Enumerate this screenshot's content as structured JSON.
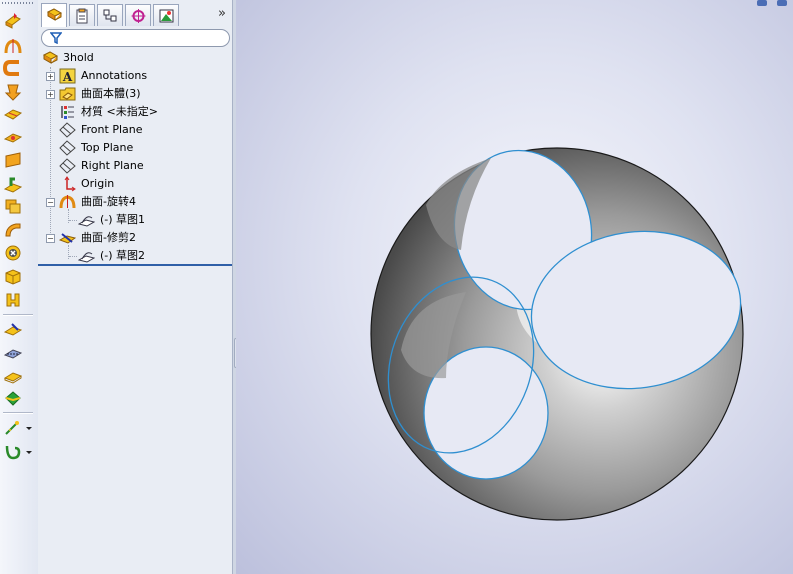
{
  "window": {
    "app": "SolidWorks"
  },
  "toolbar": {
    "buttons": [
      {
        "name": "extruded-surface-icon"
      },
      {
        "name": "revolved-surface-icon"
      },
      {
        "name": "swept-surface-icon"
      },
      {
        "name": "lofted-surface-icon"
      },
      {
        "name": "boundary-surface-icon"
      },
      {
        "name": "planar-surface-icon"
      },
      {
        "name": "filled-surface-icon"
      },
      {
        "name": "offset-surface-icon"
      },
      {
        "name": "ruled-surface-icon"
      },
      {
        "name": "delete-face-icon"
      },
      {
        "name": "replace-face-icon"
      },
      {
        "name": "untrim-surface-icon"
      },
      {
        "name": "extend-surface-icon"
      },
      {
        "name": "trim-surface-icon"
      },
      {
        "name": "knit-surface-icon"
      },
      {
        "name": "thicken-icon"
      },
      {
        "name": "fillet-dropdown-icon"
      },
      {
        "name": "curves-dropdown-icon"
      }
    ]
  },
  "panel": {
    "tabs": [
      {
        "name": "featuremanager-tab",
        "active": true
      },
      {
        "name": "propertymanager-tab",
        "active": false
      },
      {
        "name": "configurationmanager-tab",
        "active": false
      },
      {
        "name": "dimxpert-tab",
        "active": false
      },
      {
        "name": "display-manager-tab",
        "active": false
      }
    ],
    "expand_label": "»",
    "tree": {
      "root": "3hold",
      "items": [
        {
          "label": "Annotations",
          "expander": "+"
        },
        {
          "label": "曲面本體(3)",
          "expander": "+"
        },
        {
          "label": "材質 <未指定>"
        },
        {
          "label": "Front Plane"
        },
        {
          "label": "Top Plane"
        },
        {
          "label": "Right Plane"
        },
        {
          "label": "Origin"
        },
        {
          "label": "曲面-旋转4",
          "expander": "−"
        },
        {
          "label": "(-) 草图1"
        },
        {
          "label": "曲面-修剪2",
          "expander": "−"
        },
        {
          "label": "(-) 草图2"
        }
      ]
    }
  },
  "viewport": {
    "background_top": "#f6f7fc",
    "background_edge": "#bcc0dc",
    "edge_color": "#2f8fd0",
    "model": "sphere-with-trimmed-circular-openings"
  }
}
